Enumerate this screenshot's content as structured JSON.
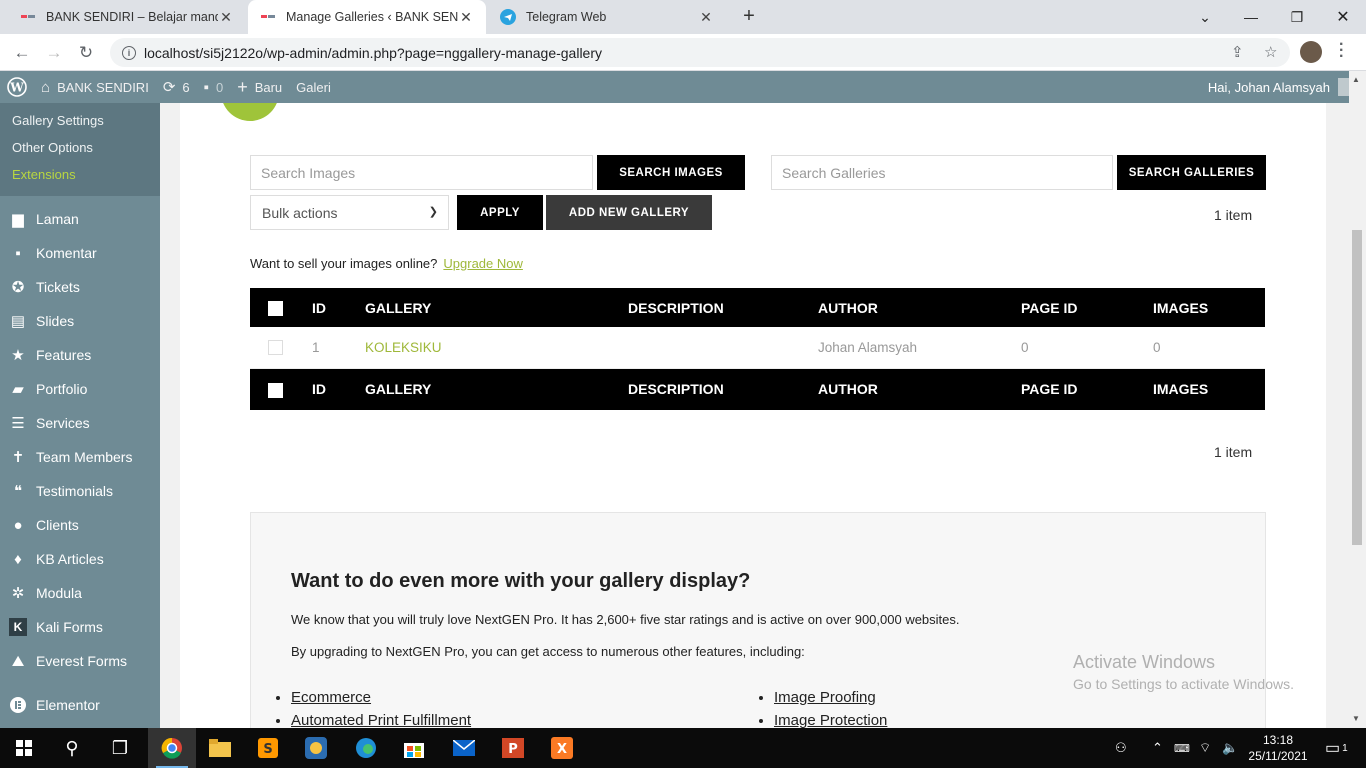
{
  "browser": {
    "tabs": [
      {
        "title": "BANK SENDIRI – Belajar mandiri",
        "active": false
      },
      {
        "title": "Manage Galleries ‹ BANK SENDIRI",
        "active": true
      },
      {
        "title": "Telegram Web",
        "active": false
      }
    ],
    "url": "localhost/si5j2122o/wp-admin/admin.php?page=nggallery-manage-gallery"
  },
  "adminbar": {
    "site": "BANK SENDIRI",
    "updates": "6",
    "comments": "0",
    "new_label": "Baru",
    "gallery_label": "Galeri",
    "greeting": "Hai, Johan Alamsyah"
  },
  "sidebar": {
    "submenu": [
      "Gallery Settings",
      "Other Options",
      "Extensions"
    ],
    "items": [
      {
        "label": "Laman",
        "icon": "page-icon"
      },
      {
        "label": "Komentar",
        "icon": "comment-icon"
      },
      {
        "label": "Tickets",
        "icon": "lifebuoy-icon"
      },
      {
        "label": "Slides",
        "icon": "slides-icon"
      },
      {
        "label": "Features",
        "icon": "star-icon"
      },
      {
        "label": "Portfolio",
        "icon": "folder-icon"
      },
      {
        "label": "Services",
        "icon": "list-icon"
      },
      {
        "label": "Team Members",
        "icon": "person-icon"
      },
      {
        "label": "Testimonials",
        "icon": "testimonial-icon"
      },
      {
        "label": "Clients",
        "icon": "user-icon"
      },
      {
        "label": "KB Articles",
        "icon": "graduation-cap-icon"
      },
      {
        "label": "Modula",
        "icon": "gear-icon"
      },
      {
        "label": "Kali Forms",
        "icon": "k-icon"
      },
      {
        "label": "Everest Forms",
        "icon": "everest-icon"
      },
      {
        "label": "Elementor",
        "icon": "elementor-icon"
      }
    ]
  },
  "main": {
    "search_images_placeholder": "Search Images",
    "search_images_button": "SEARCH IMAGES",
    "search_galleries_placeholder": "Search Galleries",
    "search_galleries_button": "SEARCH GALLERIES",
    "bulk_actions": "Bulk actions",
    "apply_button": "APPLY",
    "add_gallery_button": "ADD NEW GALLERY",
    "item_count": "1 item",
    "sell_text": "Want to sell your images online?",
    "upgrade_link": "Upgrade Now",
    "table": {
      "headers": [
        "ID",
        "GALLERY",
        "DESCRIPTION",
        "AUTHOR",
        "PAGE ID",
        "IMAGES"
      ],
      "rows": [
        {
          "id": "1",
          "gallery": "KOLEKSIKU",
          "description": "",
          "author": "Johan Alamsyah",
          "page_id": "0",
          "images": "0"
        }
      ]
    },
    "promo": {
      "title": "Want to do even more with your gallery display?",
      "p1": "We know that you will truly love NextGEN Pro. It has 2,600+ five star ratings and is active on over 900,000 websites.",
      "p2": "By upgrading to NextGEN Pro, you can get access to numerous other features, including:",
      "features_left": [
        "Ecommerce",
        "Automated Print Fulfillment"
      ],
      "features_right": [
        "Image Proofing",
        "Image Protection"
      ]
    }
  },
  "watermark": {
    "line1": "Activate Windows",
    "line2": "Go to Settings to activate Windows."
  },
  "taskbar": {
    "time": "13:18",
    "date": "25/11/2021",
    "notifications": "1"
  }
}
